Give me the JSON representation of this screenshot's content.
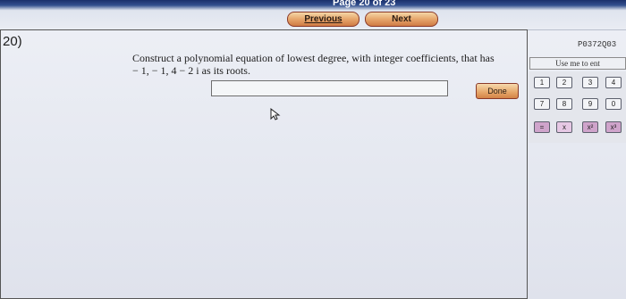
{
  "nav": {
    "page_indicator": "Page 20 of 23",
    "previous_label": "Previous",
    "next_label": "Next"
  },
  "question": {
    "number": "20)",
    "text_line1": "Construct a polynomial equation of lowest degree, with integer coefficients, that has",
    "text_line2": "− 1, − 1, 4 − 2 i  as its roots.",
    "answer_value": "",
    "done_label": "Done",
    "id": "P0372Q03"
  },
  "palette": {
    "instruction": "Use me to ent",
    "row1": [
      "1",
      "2",
      "3",
      "4"
    ],
    "row2": [
      "7",
      "8",
      "9",
      "0"
    ],
    "row3": [
      "=",
      "x",
      "x²",
      "x³"
    ]
  },
  "colors": {
    "nav_button": "#e6a66b",
    "top_bar": "#1a2f6b",
    "palette_pink": "#cfa4cb"
  },
  "icons": {
    "cursor": "arrow-pointer"
  }
}
